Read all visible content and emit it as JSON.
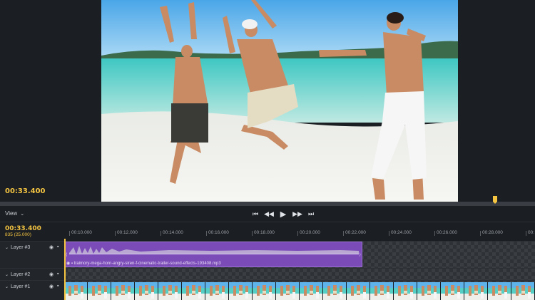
{
  "preview": {
    "timecode": "00:33.400"
  },
  "transport": {
    "view_label": "View",
    "buttons": [
      "⏮",
      "◀◀",
      "▶",
      "▶▶",
      "⏭"
    ]
  },
  "timeline": {
    "timecode": "00:33.400",
    "frame": "835 (25.000)",
    "ruler_ticks": [
      "00:10.000",
      "00:12.000",
      "00:14.000",
      "00:16.000",
      "00:18.000",
      "00:20.000",
      "00:22.000",
      "00:24.000",
      "00:26.000",
      "00:28.000",
      "00:"
    ],
    "tracks": [
      {
        "name": "Layer #3"
      },
      {
        "name": "Layer #2"
      },
      {
        "name": "Layer #1"
      }
    ],
    "audio_clip": {
      "filename": "traimory-mega-horn-angry-siren-f-cinematic-trailer-sound-effects-193408.mp3"
    }
  },
  "colors": {
    "accent": "#f5c542",
    "audio_clip": "#7b4bb8",
    "panel": "#1b1e22"
  }
}
